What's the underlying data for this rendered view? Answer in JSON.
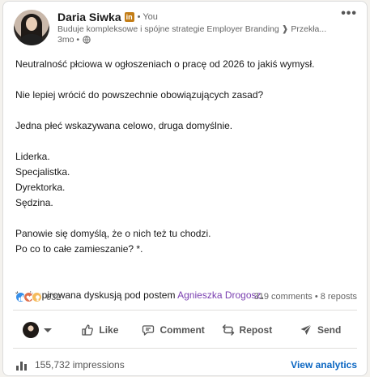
{
  "author": {
    "name": "Daria Siwka",
    "badge": "in",
    "relation": "• You",
    "headline": "Buduje kompleksowe i spójne strategie Employer Branding ❱ Przekła...",
    "time": "3mo •"
  },
  "post": {
    "lines": [
      "Neutralność płciowa w ogłoszeniach o pracę od 2026 to jakiś wymysł.",
      "",
      "Nie lepiej wrócić do powszechnie obowiązujących zasad?",
      "",
      "Jedna płeć wskazywana celowo, druga domyślnie.",
      "",
      "Liderka.",
      "Specjalistka.",
      "Dyrektorka.",
      "Sędzina.",
      "",
      "Panowie się domyślą, że o nich też tu chodzi.",
      "Po co to całe zamieszanie? *.",
      "",
      ""
    ],
    "footnote_prefix": "*zainspirowana dyskusją pod postem ",
    "footnote_mention": "Agnieszka Drogosz",
    "footnote_suffix": "."
  },
  "social": {
    "reaction_count": "632",
    "comments_reposts": "319 comments • 8 reposts"
  },
  "actions": {
    "like": "Like",
    "comment": "Comment",
    "repost": "Repost",
    "send": "Send"
  },
  "footer": {
    "impressions": "155,732 impressions",
    "view_analytics": "View analytics"
  },
  "colors": {
    "accent": "#0a66c2",
    "mention": "#7a3fb0",
    "badge": "#c37d16"
  },
  "icons": [
    "globe-icon",
    "more-icon",
    "like-icon",
    "comment-icon",
    "repost-icon",
    "send-icon",
    "analytics-icon",
    "caret-down-icon"
  ]
}
